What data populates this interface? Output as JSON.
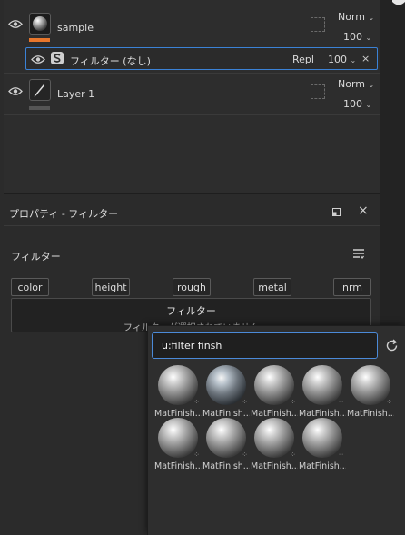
{
  "layers": [
    {
      "name": "sample",
      "blend": "Norm",
      "opacity": "100"
    },
    {
      "name": "Layer 1",
      "blend": "Norm",
      "opacity": "100"
    }
  ],
  "filter_row": {
    "label": "フィルター (なし)",
    "blend": "Repl",
    "opacity": "100"
  },
  "properties": {
    "title": "プロパティ - フィルター",
    "section": "フィルター",
    "tags": [
      "color",
      "height",
      "rough",
      "metal",
      "nrm"
    ],
    "filter_box_title": "フィルター",
    "filter_box_subtitle": "フィルターが選択されていません"
  },
  "search": {
    "value": "u:filter finsh"
  },
  "materials": [
    {
      "label": "MatFinish..."
    },
    {
      "label": "MatFinish..."
    },
    {
      "label": "MatFinish..."
    },
    {
      "label": "MatFinish..."
    },
    {
      "label": "MatFinish..."
    },
    {
      "label": "MatFinish..."
    },
    {
      "label": "MatFinish..."
    },
    {
      "label": "MatFinish..."
    },
    {
      "label": "MatFinish..."
    }
  ],
  "colors": {
    "accent_orange": "#e8762b",
    "selection_blue": "#3b82d6"
  }
}
